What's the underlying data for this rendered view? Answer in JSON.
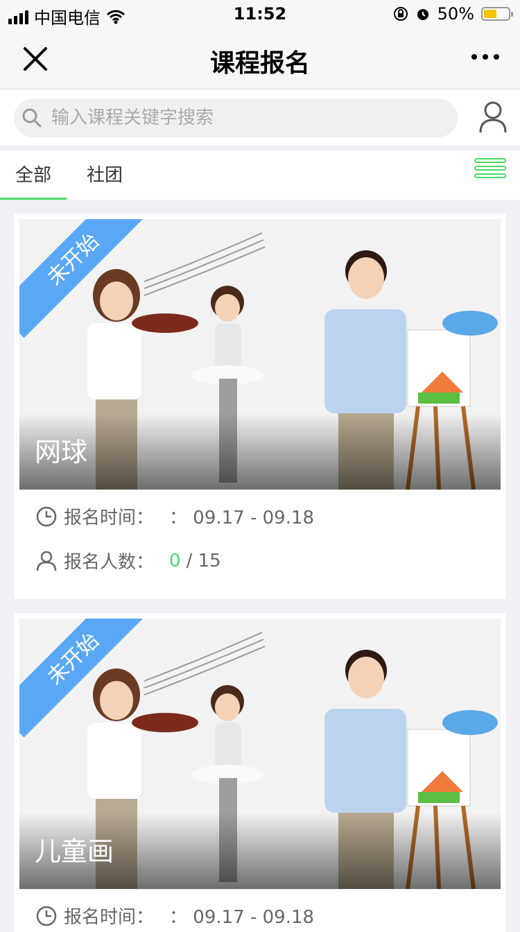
{
  "status_bar": {
    "carrier": "中国电信",
    "time": "11:52",
    "battery_percent": "50%"
  },
  "navbar": {
    "title": "课程报名"
  },
  "search": {
    "placeholder": "输入课程关键字搜索"
  },
  "tabs": [
    {
      "label": "全部",
      "active": true
    },
    {
      "label": "社团",
      "active": false
    }
  ],
  "courses": [
    {
      "badge": "未开始",
      "name": "网球",
      "time_label": "报名时间：",
      "time_value": "： 09.17 - 09.18",
      "people_label": "报名人数：",
      "enrolled": "0",
      "capacity": "/ 15"
    },
    {
      "badge": "未开始",
      "name": "儿童画",
      "time_label": "报名时间：",
      "time_value": "： 09.17 - 09.18"
    }
  ],
  "colors": {
    "accent_green": "#4cd964",
    "badge_blue": "#5aa8f5"
  },
  "icons": {
    "clock": "clock-icon",
    "person": "person-icon",
    "search": "search-icon",
    "user": "user-icon",
    "close": "close-icon",
    "more": "more-icon",
    "list": "list-view-icon"
  }
}
